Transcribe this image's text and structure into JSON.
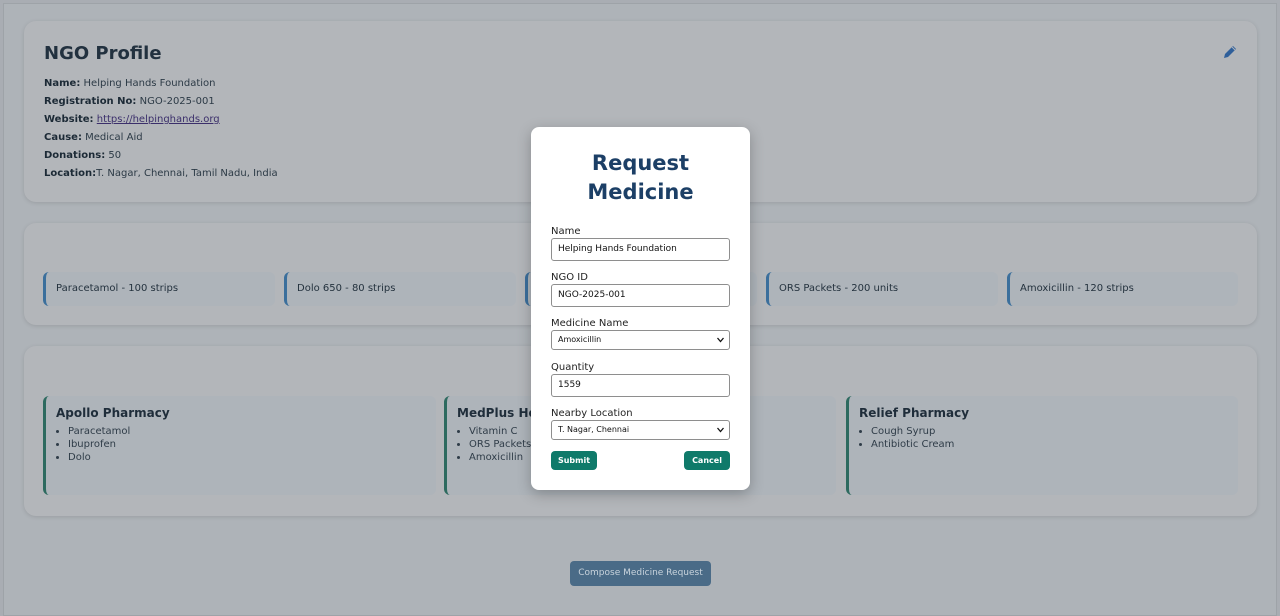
{
  "profile": {
    "title": "NGO Profile",
    "fields": [
      {
        "label": "Name:",
        "value": "Helping Hands Foundation"
      },
      {
        "label": "Registration No:",
        "value": "NGO-2025-001"
      },
      {
        "label": "Website:",
        "value": "https://helpinghands.org",
        "link": true
      },
      {
        "label": "Cause:",
        "value": "Medical Aid"
      },
      {
        "label": "Donations:",
        "value": "50"
      },
      {
        "label": "Location:",
        "value": "T. Nagar, Chennai, Tamil Nadu, India"
      }
    ]
  },
  "stock": [
    "Paracetamol - 100 strips",
    "Dolo 650 - 80 strips",
    "",
    "ORS Packets - 200 units",
    "Amoxicillin - 120 strips"
  ],
  "pharmacies": [
    {
      "name": "Apollo Pharmacy",
      "items": [
        "Paracetamol",
        "Ibuprofen",
        "Dolo"
      ]
    },
    {
      "name": "MedPlus Hosp",
      "items": [
        "Vitamin C",
        "ORS Packets",
        "Amoxicillin"
      ]
    },
    {
      "name": "Relief Pharmacy",
      "items": [
        "Cough Syrup",
        "Antibiotic Cream"
      ]
    }
  ],
  "compose_label": "Compose Medicine Request",
  "modal": {
    "title_line1": "Request",
    "title_line2": "Medicine",
    "name_label": "Name",
    "name_value": "Helping Hands Foundation",
    "ngo_label": "NGO ID",
    "ngo_value": "NGO-2025-001",
    "medicine_label": "Medicine Name",
    "medicine_value": "Amoxicillin",
    "quantity_label": "Quantity",
    "quantity_value": "1559",
    "location_label": "Nearby Location",
    "location_value": "T. Nagar, Chennai",
    "submit_label": "Submit",
    "cancel_label": "Cancel"
  },
  "colors": {
    "overlay": "#a9adb3",
    "modal_title": "#1c3f66",
    "button": "#0f7a6a",
    "stock_border": "#3b6f9c",
    "pharmacy_border": "#2d6a5f"
  },
  "icons": {
    "edit": "pencil-icon",
    "select": "chevron-down-icon"
  }
}
